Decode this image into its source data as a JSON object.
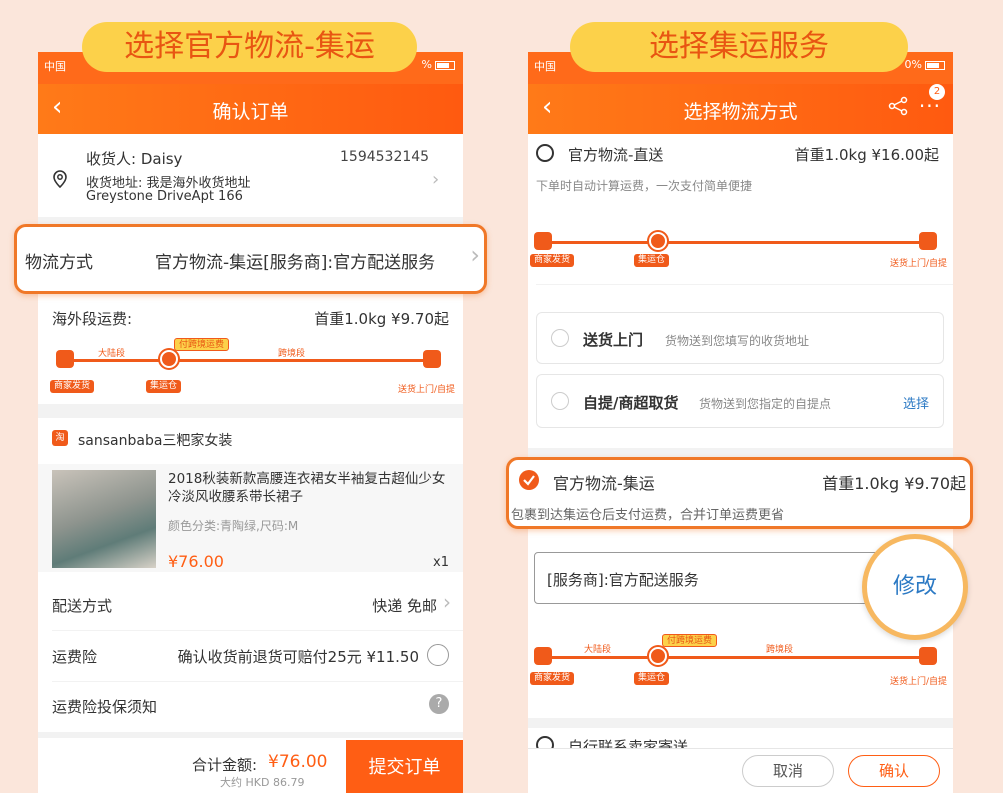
{
  "left": {
    "callout": "选择官方物流-集运",
    "carrier": "中国",
    "status_right": "%",
    "nav_title": "确认订单",
    "recipient_label": "收货人: Daisy",
    "phone": "1594532145",
    "address_line1": "收货地址: 我是海外收货地址",
    "address_line2": "Greystone DriveApt 166",
    "logistics_label": "物流方式",
    "logistics_value": "官方物流-集运[服务商]:官方配送服务",
    "overseas_fee_label": "海外段运费:",
    "overseas_fee_value": "首重1.0kg ¥9.70起",
    "route": {
      "mainland": "大陆段",
      "pay_cross": "付跨境运费",
      "cross": "跨境段",
      "merchant": "商家发货",
      "warehouse": "集运仓",
      "delivery": "送货上门/自提"
    },
    "shop_name": "sansanbaba三粑家女装",
    "product_title": "2018秋装新款高腰连衣裙女半袖复古超仙少女冷淡风收腰系带长裙子",
    "product_spec": "颜色分类:青陶绿,尺码:M",
    "product_price": "¥76.00",
    "product_qty": "x1",
    "shipping_label": "配送方式",
    "shipping_value": "快递 免邮",
    "insurance_label": "运费险",
    "insurance_value": "确认收货前退货可赔付25元 ¥11.50",
    "insurance_notice": "运费险投保须知",
    "total_label": "合计金额:",
    "total_value": "¥76.00",
    "total_hkd": "大约 HKD 86.79",
    "submit": "提交订单"
  },
  "right": {
    "callout": "选择集运服务",
    "carrier": "中国",
    "status_right": "0%",
    "nav_title": "选择物流方式",
    "more_badge": "2",
    "opt1_label": "官方物流-直送",
    "opt1_price": "首重1.0kg ¥16.00起",
    "opt1_desc": "下单时自动计算运费，一次支付简单便捷",
    "route1": {
      "merchant": "商家发货",
      "warehouse": "集运仓",
      "delivery": "送货上门/自提"
    },
    "door_label": "送货上门",
    "door_desc": "货物送到您填写的收货地址",
    "pickup_label": "自提/商超取货",
    "pickup_desc": "货物送到您指定的自提点",
    "pickup_action": "选择",
    "opt2_label": "官方物流-集运",
    "opt2_price": "首重1.0kg ¥9.70起",
    "opt2_desc": "包裹到达集运仓后支付运费，合并订单运费更省",
    "provider": "[服务商]:官方配送服务",
    "modify": "修改",
    "route2": {
      "mainland": "大陆段",
      "pay_cross": "付跨境运费",
      "cross": "跨境段",
      "merchant": "商家发货",
      "warehouse": "集运仓",
      "delivery": "送货上门/自提"
    },
    "opt3_label": "自行联系卖家寄送",
    "cancel": "取消",
    "confirm": "确认"
  },
  "colors": {
    "accent": "#ff5e14",
    "callout": "#fcd14a",
    "background": "#fbe6db",
    "link": "#2b79c4"
  }
}
